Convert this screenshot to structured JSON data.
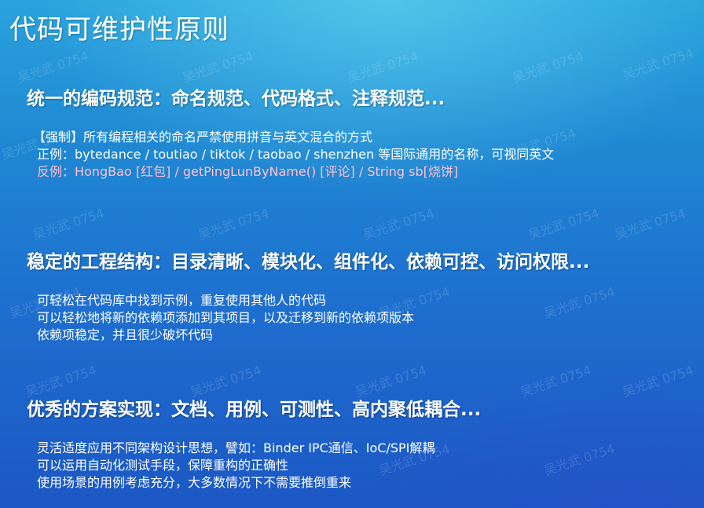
{
  "title": "代码可维护性原则",
  "watermark": "吴光武 0754",
  "sections": [
    {
      "heading": "统一的编码规范：命名规范、代码格式、注释规范...",
      "lines": [
        "【强制】所有编程相关的命名严禁使用拼音与英文混合的方式",
        "正例：bytedance / toutiao / tiktok / taobao / shenzhen 等国际通用的名称，可视同英文",
        "反例：HongBao [红包] / getPingLunByName() [评论] / String sb[烧饼]"
      ]
    },
    {
      "heading": "稳定的工程结构：目录清晰、模块化、组件化、依赖可控、访问权限...",
      "lines": [
        "可轻松在代码库中找到示例，重复使用其他人的代码",
        "可以轻松地将新的依赖项添加到其项目，以及迁移到新的依赖项版本",
        "依赖项稳定，并且很少破坏代码"
      ]
    },
    {
      "heading": "优秀的方案实现：文档、用例、可测性、高内聚低耦合...",
      "lines": [
        "灵活适度应用不同架构设计思想，譬如：Binder IPC通信、IoC/SPI解耦",
        "可以运用自动化测试手段，保障重构的正确性",
        "使用场景的用例考虑充分，大多数情况下不需要推倒重来"
      ]
    }
  ]
}
